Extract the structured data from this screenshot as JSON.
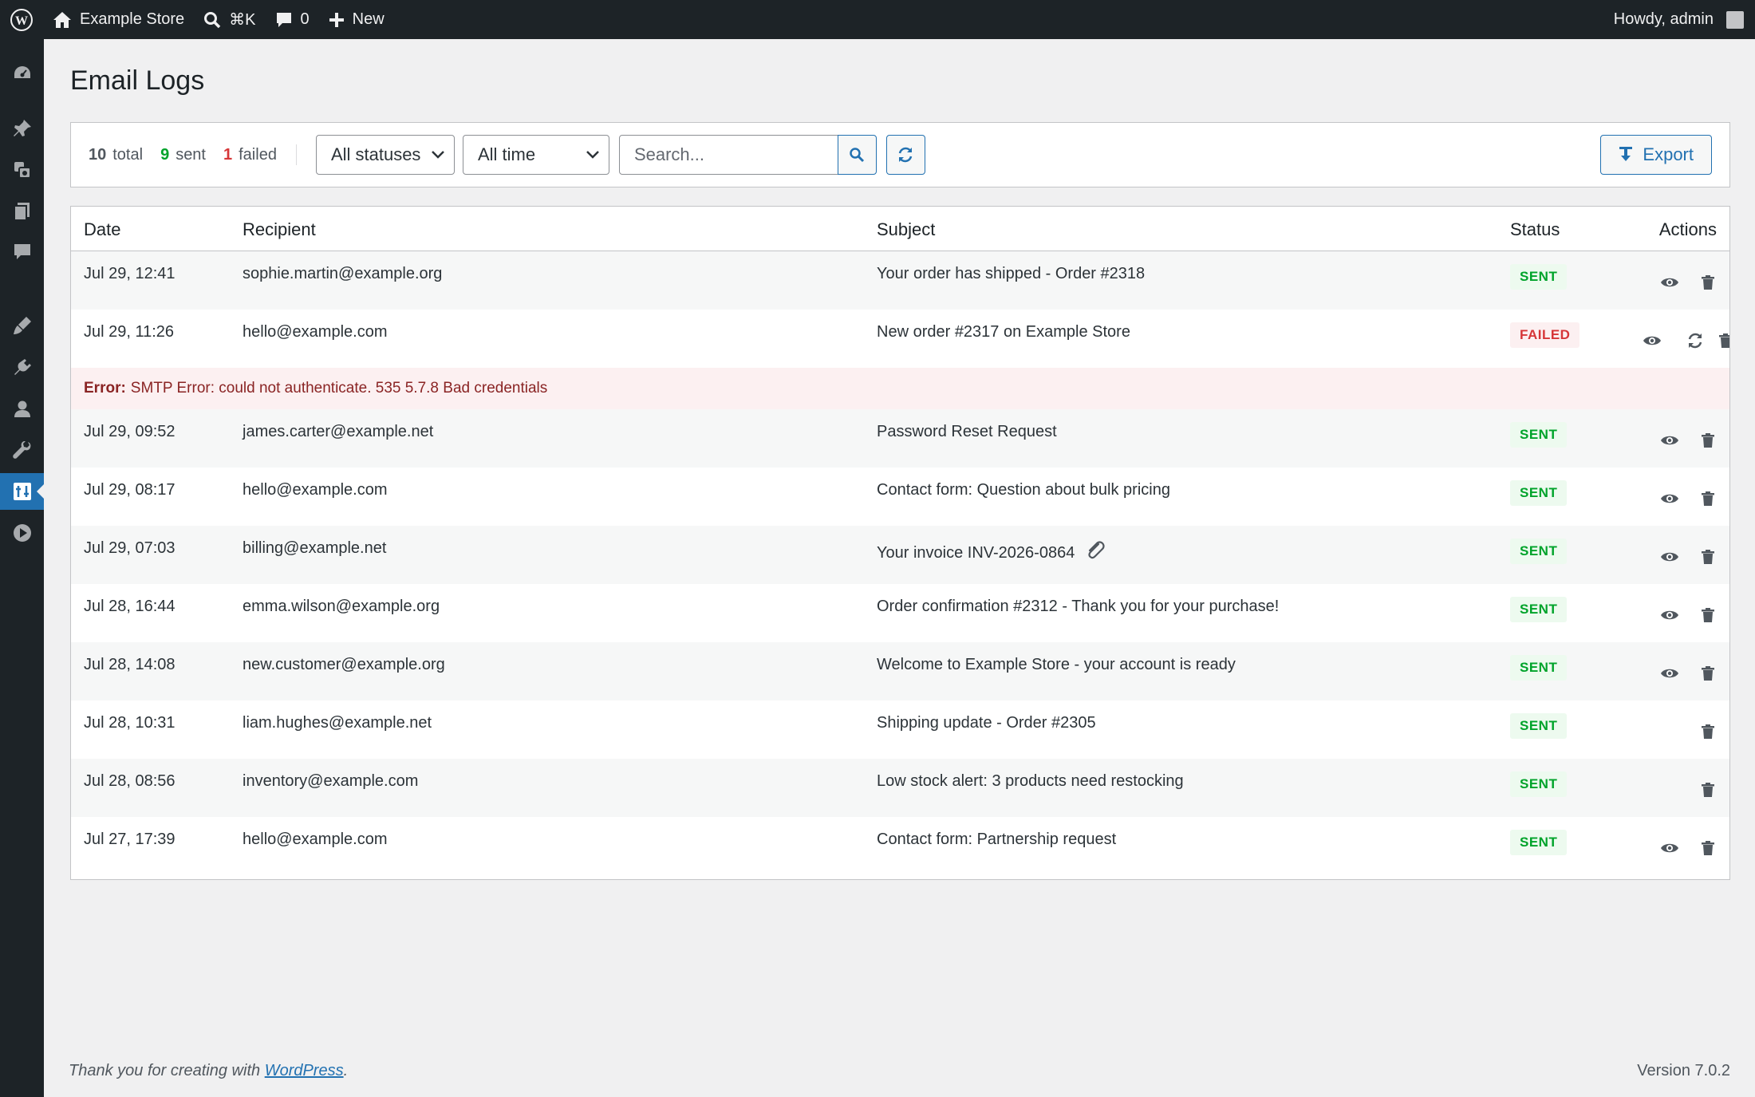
{
  "adminbar": {
    "site_name": "Example Store",
    "search_shortcut": "⌘K",
    "comments_count": "0",
    "new_label": "New",
    "greeting": "Howdy, admin"
  },
  "page": {
    "title": "Email Logs"
  },
  "toolbar": {
    "total_count": "10",
    "total_label": "total",
    "sent_count": "9",
    "sent_label": "sent",
    "failed_count": "1",
    "failed_label": "failed",
    "status_select": "All statuses",
    "time_select": "All time",
    "search_placeholder": "Search...",
    "export_label": "Export"
  },
  "table": {
    "headers": {
      "date": "Date",
      "recipient": "Recipient",
      "subject": "Subject",
      "status": "Status",
      "actions": "Actions"
    },
    "rows": [
      {
        "date": "Jul 29, 12:41",
        "recipient": "sophie.martin@example.org",
        "subject": "Your order has shipped - Order #2318",
        "status": "SENT"
      },
      {
        "date": "Jul 29, 11:26",
        "recipient": "hello@example.com",
        "subject": "New order #2317 on Example Store",
        "status": "FAILED"
      },
      {
        "date": "Jul 29, 09:52",
        "recipient": "james.carter@example.net",
        "subject": "Password Reset Request",
        "status": "SENT"
      },
      {
        "date": "Jul 29, 08:17",
        "recipient": "hello@example.com",
        "subject": "Contact form: Question about bulk pricing",
        "status": "SENT"
      },
      {
        "date": "Jul 29, 07:03",
        "recipient": "billing@example.net",
        "subject": "Your invoice INV-2026-0864",
        "status": "SENT"
      },
      {
        "date": "Jul 28, 16:44",
        "recipient": "emma.wilson@example.org",
        "subject": "Order confirmation #2312 - Thank you for your purchase!",
        "status": "SENT"
      },
      {
        "date": "Jul 28, 14:08",
        "recipient": "new.customer@example.org",
        "subject": "Welcome to Example Store - your account is ready",
        "status": "SENT"
      },
      {
        "date": "Jul 28, 10:31",
        "recipient": "liam.hughes@example.net",
        "subject": "Shipping update - Order #2305",
        "status": "SENT"
      },
      {
        "date": "Jul 28, 08:56",
        "recipient": "inventory@example.com",
        "subject": "Low stock alert: 3 products need restocking",
        "status": "SENT"
      },
      {
        "date": "Jul 27, 17:39",
        "recipient": "hello@example.com",
        "subject": "Contact form: Partnership request",
        "status": "SENT"
      }
    ],
    "error": {
      "label": "Error:",
      "message": "SMTP Error: could not authenticate. 535 5.7.8 Bad credentials"
    }
  },
  "footer": {
    "thanks_prefix": "Thank you for creating with ",
    "thanks_link": "WordPress",
    "thanks_suffix": ".",
    "version": "Version 7.0.2"
  },
  "colors": {
    "accent": "#2271b1",
    "sent": "#00a32a",
    "failed": "#d63638",
    "adminbar": "#1d2327"
  }
}
